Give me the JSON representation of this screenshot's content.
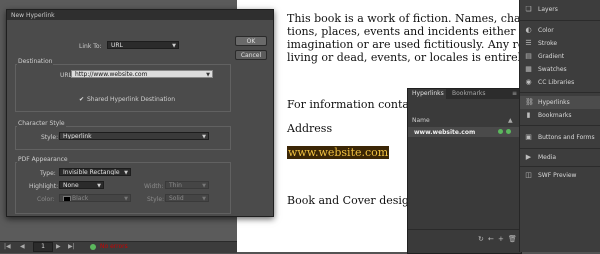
{
  "dialog": {
    "title": "New Hyperlink",
    "link_to_label": "Link To:",
    "link_to_value": "URL",
    "ok_label": "OK",
    "cancel_label": "Cancel",
    "destination_legend": "Destination",
    "url_label": "URL:",
    "url_value": "http://www.website.com",
    "shared_checkbox_label": "Shared Hyperlink Destination",
    "character_style_legend": "Character Style",
    "style_label": "Style:",
    "style_value": "Hyperlink",
    "pdf_legend": "PDF Appearance",
    "type_label": "Type:",
    "type_value": "Invisible Rectangle",
    "highlight_label": "Highlight:",
    "highlight_value": "None",
    "width_label": "Width:",
    "width_value": "Thin",
    "color_label": "Color:",
    "color_value": "Black",
    "style2_label": "Style:",
    "style2_value": "Solid"
  },
  "document": {
    "lines": [
      "This book is a work of fiction. Names, characters",
      "tions, places, events and incidents either are the p",
      "imagination or are used fictitiously. Any resembla",
      "living or dead, events, or locales is entirely coinci"
    ],
    "contact": "For information contact:",
    "address": "Address",
    "link_text": "www.website.com",
    "credit": "Book and Cover design by D"
  },
  "hyperlinks_panel": {
    "tab_active": "Hyperlinks",
    "tab_inactive": "Bookmarks",
    "column_name": "Name",
    "row_value": "www.website.com"
  },
  "right_panel": {
    "items": [
      "Layers",
      "Color",
      "Stroke",
      "Gradient",
      "Swatches",
      "CC Libraries",
      "Hyperlinks",
      "Bookmarks",
      "Buttons and Forms",
      "Media",
      "SWF Preview"
    ]
  },
  "status": {
    "page_number": "1",
    "status_text": "No errors"
  },
  "colors": {
    "accent": "#3a78c5",
    "link_highlight": "#3b2606",
    "status_ok": "#5bb85d"
  }
}
